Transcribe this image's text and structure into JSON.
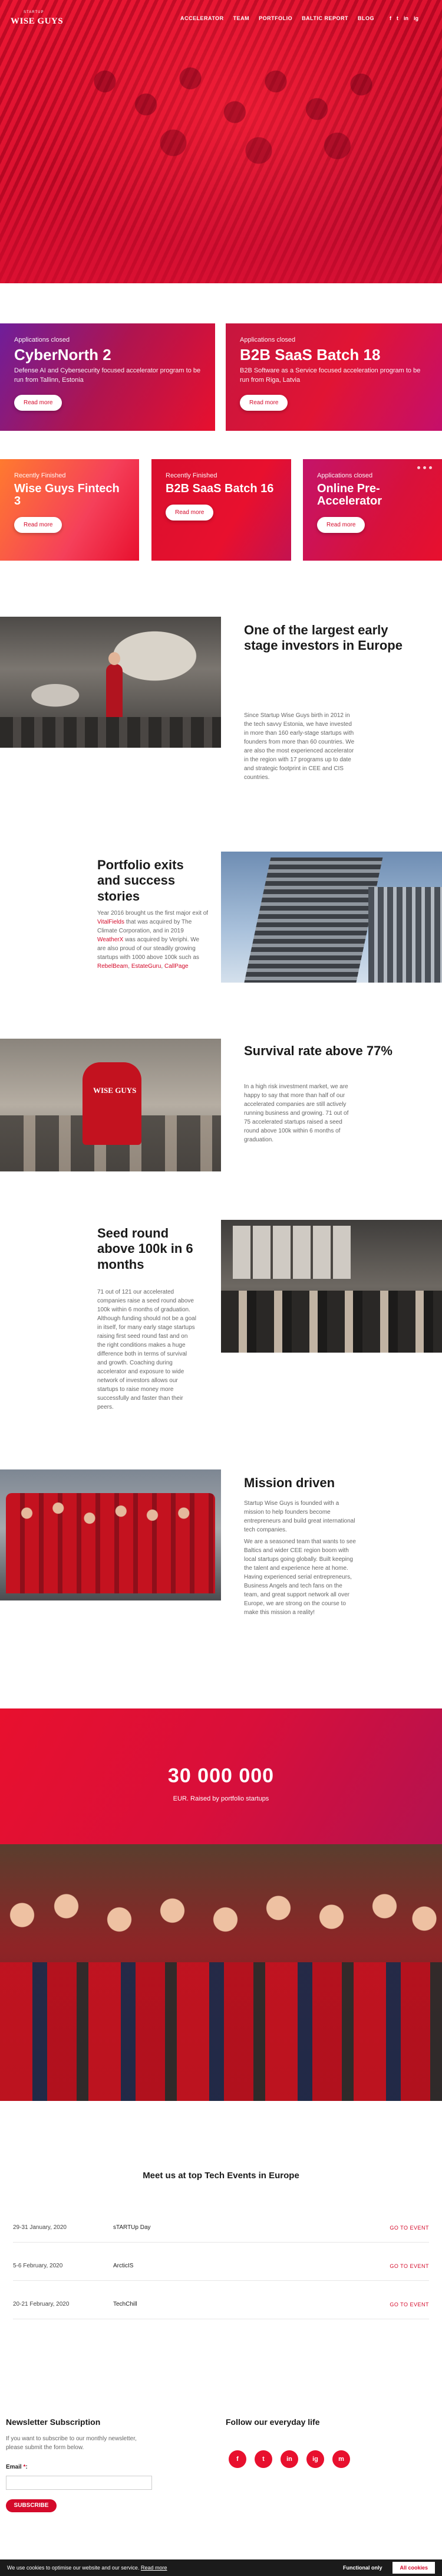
{
  "nav": {
    "logo_top": "STARTUP",
    "logo_main": "WISE GUYS",
    "menu": [
      "ACCELERATOR",
      "TEAM",
      "PORTFOLIO",
      "BALTIC REPORT",
      "BLOG"
    ],
    "socials": [
      "f",
      "t",
      "in",
      "ig"
    ]
  },
  "cards": [
    {
      "status": "Applications closed",
      "title": "CyberNorth 2",
      "text": "Defense AI and Cybersecurity focused accelerator program to be run from Tallinn, Estonia",
      "button": "Read more"
    },
    {
      "status": "Applications closed",
      "title": "B2B SaaS Batch 18",
      "text": "B2B Software as a Service focused acceleration program to be run from Riga, Latvia",
      "button": "Read more"
    },
    {
      "status": "Recently Finished",
      "title": "Wise Guys Fintech 3",
      "button": "Read more"
    },
    {
      "status": "Recently Finished",
      "title": "B2B SaaS Batch 16",
      "button": "Read more"
    },
    {
      "status": "Applications closed",
      "title": "Online Pre-Accelerator",
      "button": "Read more"
    }
  ],
  "features": [
    {
      "title": "One of the largest early stage investors in Europe",
      "text": "Since Startup Wise Guys birth in 2012 in the tech savvy Estonia, we have invested in more than 160 early-stage startups with founders from more than 60 countries. We are also the most experienced accelerator in the region with 17 programs up to date and strategic footprint in CEE and CIS countries."
    },
    {
      "title": "Portfolio exits and success stories",
      "text_before": "Year 2016 brought us the first major exit of ",
      "link1": "VitalFields",
      "text_mid": " that was acquired by The Climate Corporation, and in 2019 ",
      "link2": "WeatherX",
      "text_after": " was acquired by Veriphi. We are also proud of our steadily growing startups with 1000 above 100k such as ",
      "link3": "RebelBeam",
      "text_sep": ", ",
      "link4": "EstateGuru",
      "text_sep2": ", ",
      "link5": "CallPage"
    },
    {
      "title": "Survival rate above 77%",
      "text": "In a high risk investment market, we are happy to say that more than half of our accelerated companies are still actively running business and growing. 71 out of 75 accelerated startups raised a seed round above 100k within 6 months of graduation."
    },
    {
      "title": "Seed round above 100k in 6 months",
      "text": "71 out of 121 our accelerated companies raise a seed round above 100k within 6 months of graduation. Although funding should not be a goal in itself, for many early stage startups raising first seed round fast and on the right conditions makes a huge difference both in terms of survival and growth. Coaching during accelerator and exposure to wide network of investors allows our startups to raise money more successfully and faster than their peers."
    },
    {
      "title": "Mission driven",
      "text1": "Startup Wise Guys is founded with a mission to help founders become entrepreneurs and build great international tech companies.",
      "text2": "We are a seasoned team that wants to see Baltics and wider CEE region boom with local startups going globally. Built keeping the talent and experience here at home. Having experienced serial entrepreneurs, Business Angels and tech fans on the team, and great support network all over Europe, we are strong on the course to make this mission a reality!"
    }
  ],
  "stat": {
    "number": "30 000 000",
    "label": "EUR. Raised by portfolio startups"
  },
  "events": {
    "title": "Meet us at top Tech Events in Europe",
    "rows": [
      {
        "date": "29-31 January, 2020",
        "name": "sTARTUp Day",
        "link": "GO TO EVENT"
      },
      {
        "date": "5-6 February, 2020",
        "name": "ArcticIS",
        "link": "GO TO EVENT"
      },
      {
        "date": "20-21 February, 2020",
        "name": "TechChill",
        "link": "GO TO EVENT"
      }
    ]
  },
  "newsletter": {
    "title": "Newsletter Subscription",
    "text": "If you want to subscribe to our monthly newsletter, please submit the form below.",
    "email_label": "Email",
    "required_mark": "*",
    "colon": ":",
    "email_value": "",
    "button": "SUBSCRIBE"
  },
  "follow": {
    "title": "Follow our everyday life",
    "icons": [
      "f",
      "t",
      "in",
      "ig",
      "m"
    ]
  },
  "cookie": {
    "text": "We use cookies to optimise our website and our service.",
    "link": "Read more",
    "functional": "Functional only",
    "all": "All cookies"
  },
  "colors": {
    "brand": "#e8102e",
    "dark": "#1a1a1a"
  }
}
